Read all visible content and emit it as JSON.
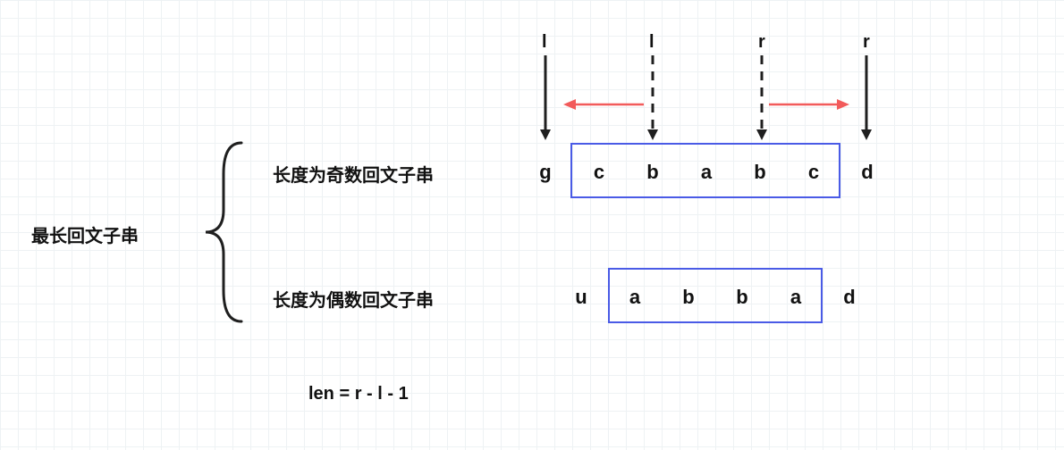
{
  "title": "最长回文子串",
  "cases": {
    "odd": {
      "label": "长度为奇数回文子串",
      "chars": [
        "g",
        "c",
        "b",
        "a",
        "b",
        "c",
        "d"
      ]
    },
    "even": {
      "label": "长度为偶数回文子串",
      "chars": [
        "u",
        "a",
        "b",
        "b",
        "a",
        "d"
      ]
    }
  },
  "markers": {
    "l1": "l",
    "l2": "l",
    "r1": "r",
    "r2": "r"
  },
  "formula": "len = r - l - 1",
  "colors": {
    "box": "#4a5be6",
    "red": "#f25b5b",
    "arrow": "#1f1f1f"
  }
}
